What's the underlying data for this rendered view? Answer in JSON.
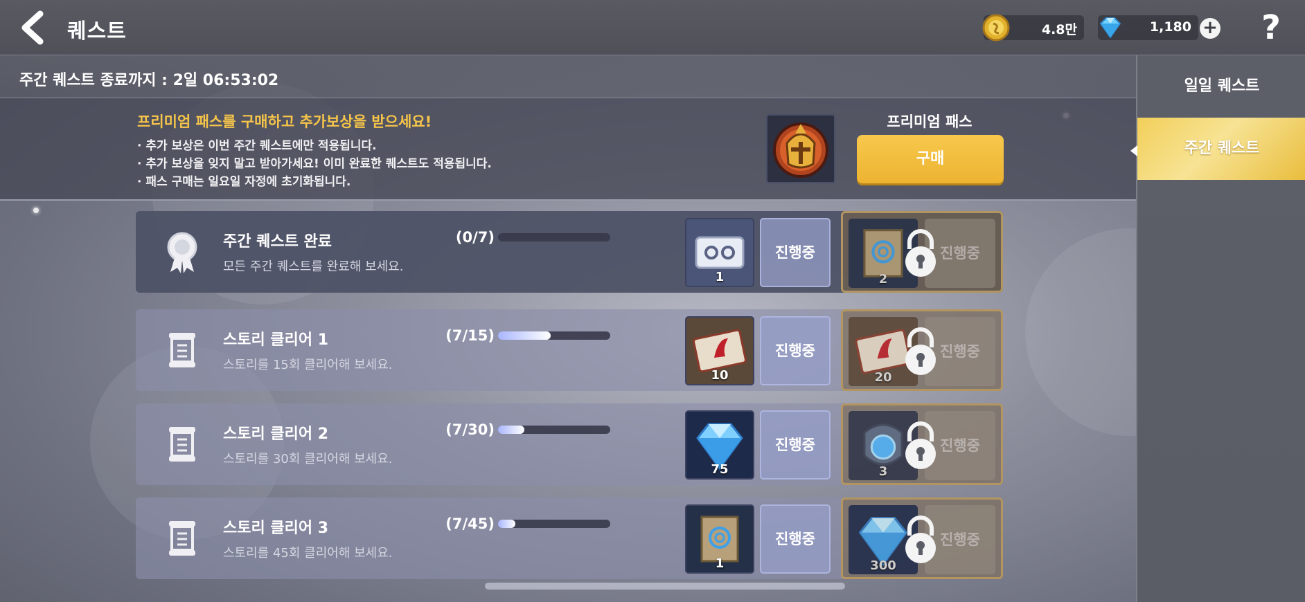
{
  "header": {
    "title": "퀘스트",
    "gold_value": "4.8만",
    "gem_value": "1,180",
    "plus_label": "+",
    "help_label": "?"
  },
  "timer": {
    "text": "주간 퀘스트 종료까지 : 2일 06:53:02"
  },
  "premium": {
    "title": "프리미엄 패스를 구매하고 추가보상을 받으세요!",
    "lines": [
      "· 추가 보상은 이번 주간 퀘스트에만 적용됩니다.",
      "· 추가 보상을 잊지 말고 받아가세요! 이미 완료한 퀘스트도 적용됩니다.",
      "· 패스 구매는 일요일 자정에 초기화됩니다."
    ],
    "pass_label": "프리미엄 패스",
    "buy_label": "구매"
  },
  "side": {
    "tabs": [
      {
        "label": "일일 퀘스트"
      },
      {
        "label": "주간 퀘스트"
      }
    ]
  },
  "quests": [
    {
      "title": "주간 퀘스트 완료",
      "desc": "모든 주간 퀘스트를 완료해 보세요.",
      "progress": "(0/7)",
      "fraction": 0.0,
      "reward_icon": "ticket-icon",
      "reward_count": "1",
      "status": "진행중",
      "premium_icon": "scroll-icon",
      "premium_count": "2",
      "premium_status": "진행중"
    },
    {
      "title": "스토리 클리어 1",
      "desc": "스토리를 15회 클리어해 보세요.",
      "progress": "(7/15)",
      "fraction": 0.467,
      "reward_icon": "red-ticket-icon",
      "reward_count": "10",
      "status": "진행중",
      "premium_icon": "red-ticket-icon",
      "premium_count": "20",
      "premium_status": "진행중"
    },
    {
      "title": "스토리 클리어 2",
      "desc": "스토리를 30회 클리어해 보세요.",
      "progress": "(7/30)",
      "fraction": 0.233,
      "reward_icon": "diamond-icon",
      "reward_count": "75",
      "status": "진행중",
      "premium_icon": "orb-icon",
      "premium_count": "3",
      "premium_status": "진행중"
    },
    {
      "title": "스토리 클리어 3",
      "desc": "스토리를 45회 클리어해 보세요.",
      "progress": "(7/45)",
      "fraction": 0.156,
      "reward_icon": "scroll-icon",
      "reward_count": "1",
      "status": "진행중",
      "premium_icon": "diamond-icon",
      "premium_count": "300",
      "premium_status": "진행중"
    }
  ],
  "colors": {
    "accent_gold": "#f6c54a",
    "buy_button": "#efb634",
    "premium_border": "#b29560"
  }
}
